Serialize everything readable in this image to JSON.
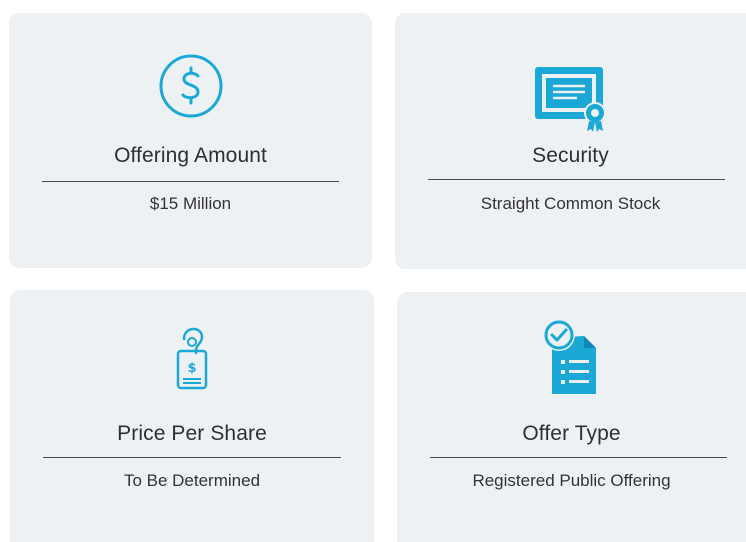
{
  "accent_color": "#1ba8d6",
  "cards": [
    {
      "icon": "dollar-circle-icon",
      "title": "Offering Amount",
      "value": "$15 Million"
    },
    {
      "icon": "certificate-icon",
      "title": "Security",
      "value": "Straight Common Stock"
    },
    {
      "icon": "price-tag-icon",
      "title": "Price Per Share",
      "value": "To Be Determined"
    },
    {
      "icon": "checked-document-icon",
      "title": "Offer Type",
      "value": "Registered Public Offering"
    }
  ]
}
